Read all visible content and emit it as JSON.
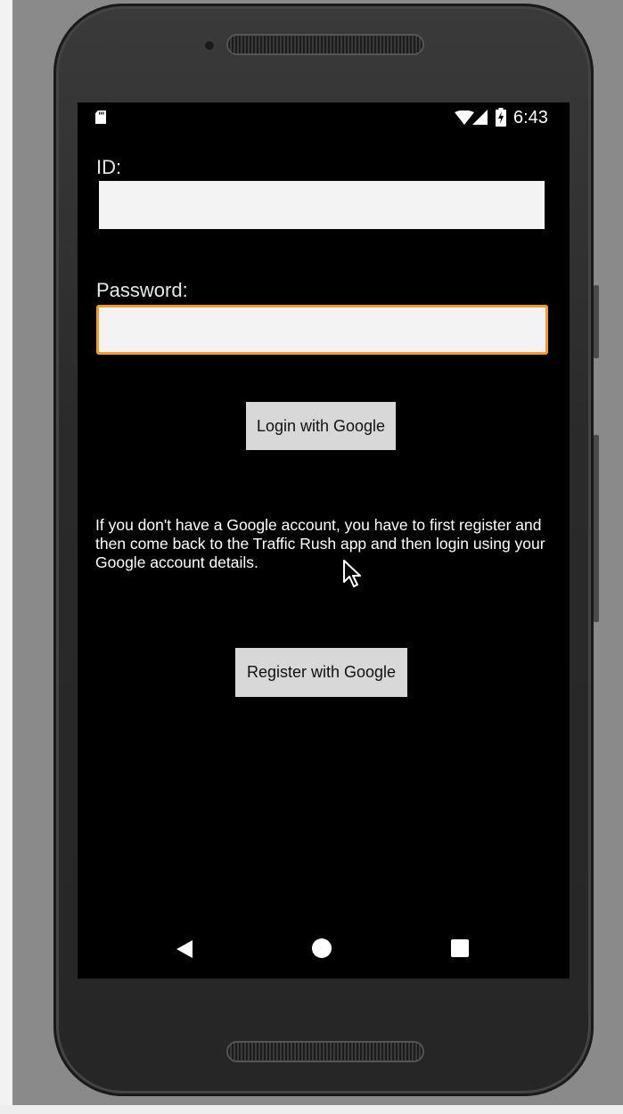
{
  "status_bar": {
    "time": "6:43",
    "icons": [
      "sd-card-icon",
      "wifi-icon",
      "cell-signal-icon",
      "battery-charging-icon"
    ]
  },
  "form": {
    "id_label": "ID:",
    "id_value": "",
    "password_label": "Password:",
    "password_value": "",
    "focused_field": "password"
  },
  "buttons": {
    "login_label": "Login with Google",
    "register_label": "Register with Google"
  },
  "info_text": "If you don't have a Google account, you have to first register and then come back to the Traffic Rush app and then login using your Google account details.",
  "nav_bar": {
    "icons": [
      "back-icon",
      "home-icon",
      "recents-icon"
    ]
  },
  "colors": {
    "focus_border": "#f39c2b",
    "screen_background": "#000000",
    "button_background": "#d8d8d8",
    "field_background": "#f3f3f3"
  }
}
